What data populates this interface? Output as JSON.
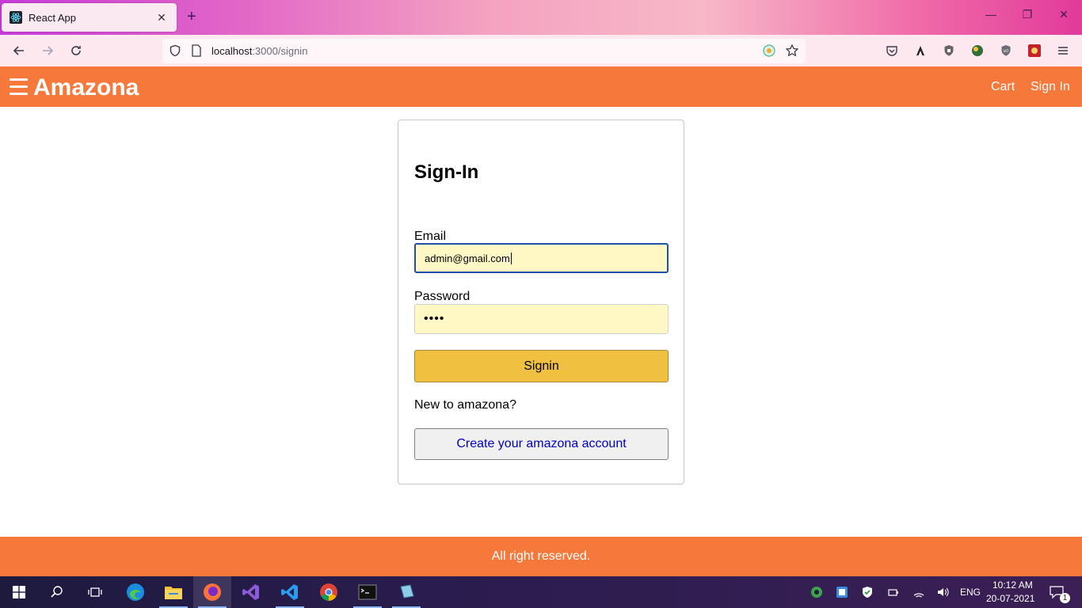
{
  "browser": {
    "tab_title": "React App",
    "url_host": "localhost",
    "url_path": ":3000/signin"
  },
  "app": {
    "brand": "Amazona",
    "nav": {
      "cart": "Cart",
      "signin": "Sign In"
    },
    "accent_color": "#f6783a"
  },
  "signin": {
    "heading": "Sign-In",
    "email_label": "Email",
    "email_value": "admin@gmail.com",
    "password_label": "Password",
    "password_value": "••••",
    "submit_label": "Signin",
    "new_prompt": "New to amazona?",
    "create_account_label": "Create your amazona account"
  },
  "footer": {
    "text": "All right reserved."
  },
  "taskbar": {
    "apps": [
      "windows-start",
      "search",
      "task-view",
      "edge",
      "file-explorer",
      "firefox",
      "visual-studio",
      "vscode",
      "chrome",
      "terminal",
      "notepad"
    ],
    "language": "ENG",
    "time": "10:12 AM",
    "date": "20-07-2021",
    "notification_count": "1"
  }
}
